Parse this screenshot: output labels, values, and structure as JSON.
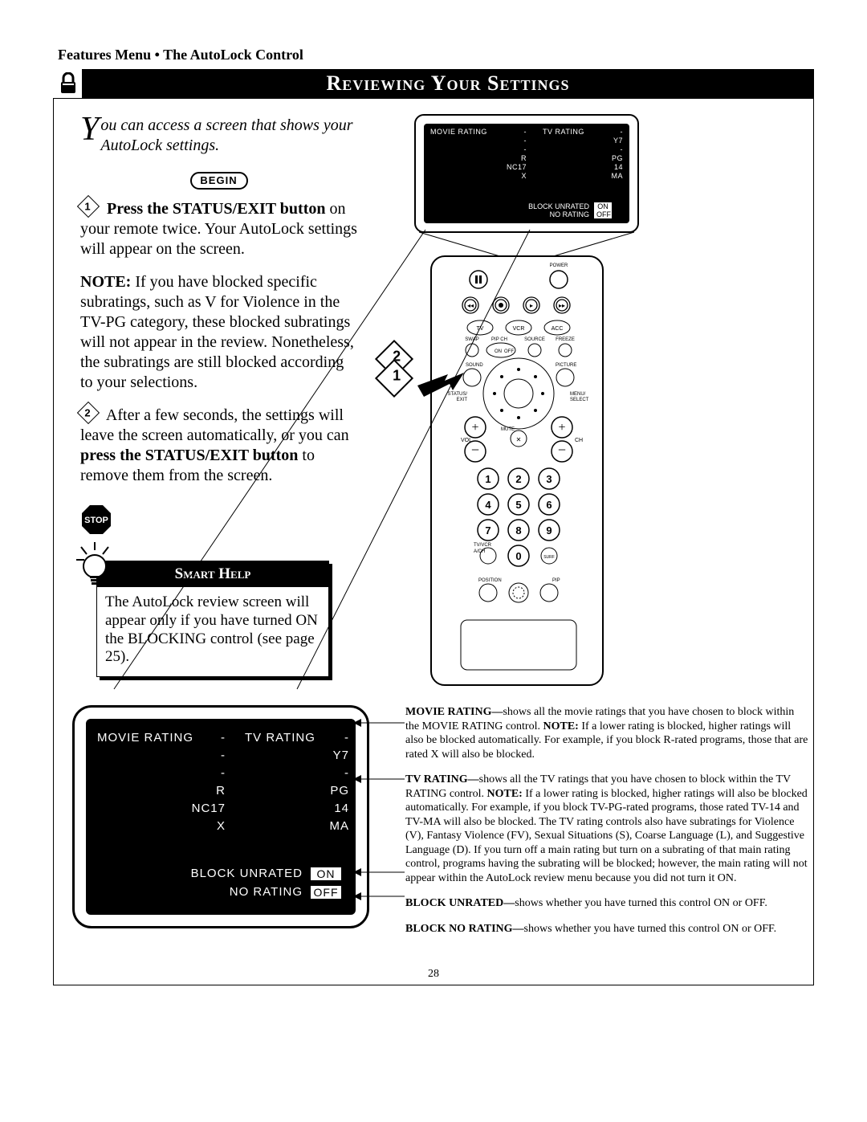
{
  "header": {
    "breadcrumb": "Features Menu • The AutoLock Control",
    "title": "Reviewing Your Settings"
  },
  "intro": {
    "dropcap": "Y",
    "rest": "ou can access a screen that shows your AutoLock settings."
  },
  "begin_label": "BEGIN",
  "steps": [
    {
      "num": "1",
      "bold": "Press the STATUS/EXIT button",
      "rest": " on your remote twice.  Your AutoLock settings will appear on the screen."
    },
    {
      "num": "2",
      "pre": "After a few seconds, the settings will leave the screen automatically, or you can ",
      "bold": "press the STATUS/EXIT button",
      "rest": " to remove them from the screen."
    }
  ],
  "note": {
    "bold": "NOTE:",
    "text": " If you have blocked specific subratings, such as V for Violence in the TV-PG category, these blocked subratings will not appear in the review. Nonetheless, the subratings are still blocked according to your selections."
  },
  "stop_label": "STOP",
  "smart": {
    "title": "Smart Help",
    "body": "The AutoLock review screen will appear only if you have turned ON the BLOCKING control (see page 25)."
  },
  "osd": {
    "movie_label": "MOVIE  RATING",
    "tv_label": "TV  RATING",
    "movie_values": [
      "-",
      "-",
      "-",
      "R",
      "NC17",
      "X"
    ],
    "tv_values": [
      "-",
      "Y7",
      "-",
      "PG",
      "14",
      "MA"
    ],
    "block_unrated": {
      "label": "BLOCK  UNRATED",
      "value": "ON"
    },
    "no_rating": {
      "label": "NO  RATING",
      "value": "OFF"
    }
  },
  "callout": {
    "n1": "1",
    "n2": "2"
  },
  "remote": {
    "labels": {
      "power": "POWER",
      "tv": "TV",
      "vcr": "VCR",
      "acc": "ACC",
      "swap": "SWAP",
      "pipch": "PIP CH",
      "source": "SOURCE",
      "freeze": "FREEZE",
      "on": "ON",
      "off": "OFF",
      "sound": "SOUND",
      "picture": "PICTURE",
      "status": "STATUS/\nEXIT",
      "menu": "MENU/\nSELECT",
      "vol": "VOL",
      "ch": "CH",
      "mute": "MUTE",
      "numbers": [
        "1",
        "2",
        "3",
        "4",
        "5",
        "6",
        "7",
        "8",
        "9",
        "0"
      ],
      "tvvcr": "TV/VCR",
      "alist": "A/CH",
      "surf": "SURF",
      "position": "POSITION",
      "pip": "PIP"
    }
  },
  "defs": {
    "movie": {
      "bold": "MOVIE RATING—",
      "text": "shows all the movie ratings that you have chosen to block within the MOVIE RATING control. ",
      "note_bold": "NOTE:",
      "note": " If a lower rating is blocked, higher ratings will also be blocked automatically. For example, if you block R-rated programs, those that are rated X will also be blocked."
    },
    "tv": {
      "bold": "TV RATING—",
      "text": "shows all the TV ratings that you have chosen to block within the TV RATING control. ",
      "note_bold": "NOTE:",
      "note": " If a lower rating is blocked, higher ratings will also be blocked automatically. For example, if you block TV-PG-rated programs, those rated TV-14 and TV-MA will also be blocked. The TV rating controls also have subratings for Violence (V), Fantasy Violence (FV), Sexual Situations (S), Coarse Language (L), and Suggestive Language (D). If you turn off a main rating but turn on a subrating of that main rating control, programs having the subrating will be blocked; however, the main rating will not appear within the AutoLock review menu because you did not turn it ON."
    },
    "bu": {
      "bold": "BLOCK UNRATED—",
      "text": "shows whether you have turned this control ON or OFF."
    },
    "bn": {
      "bold": "BLOCK NO RATING—",
      "text": "shows whether you have turned this control ON or OFF."
    }
  },
  "page_number": "28"
}
